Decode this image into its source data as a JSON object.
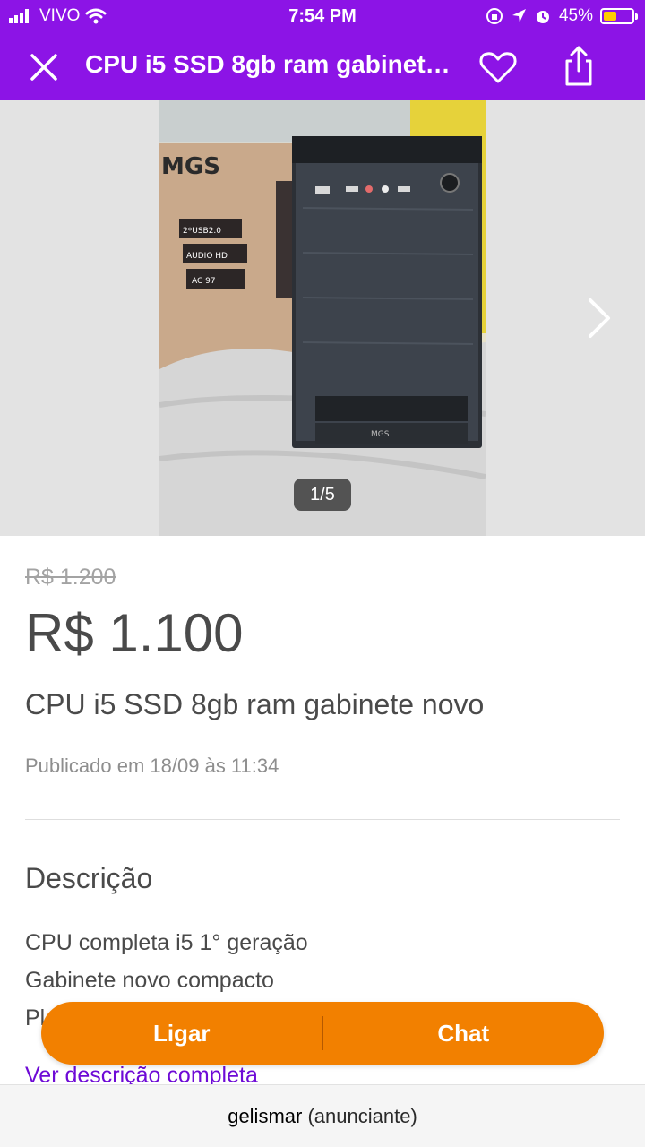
{
  "status_bar": {
    "carrier": "VIVO",
    "time": "7:54 PM",
    "battery": "45%",
    "battery_level": 0.45,
    "icons": [
      "signal-icon",
      "wifi-icon",
      "orientation-lock-icon",
      "location-icon",
      "alarm-icon",
      "battery-icon"
    ]
  },
  "app_bar": {
    "title": "CPU i5 SSD 8gb ram gabinete novo",
    "close_icon": "close-icon",
    "favorite_icon": "heart-icon",
    "share_icon": "share-icon",
    "color": "#8c14e6"
  },
  "gallery": {
    "counter": "1/5",
    "next_icon": "chevron-right-icon",
    "photo_text": {
      "brand": "MGS",
      "box_labels": [
        "2*USB2.0",
        "AUDIO HD",
        "AC 97"
      ]
    }
  },
  "listing": {
    "old_price": "R$ 1.200",
    "price": "R$ 1.100",
    "title": "CPU i5 SSD 8gb ram gabinete novo",
    "published": "Publicado em 18/09 às 11:34"
  },
  "description": {
    "heading": "Descrição",
    "lines": [
      "CPU completa i5 1° geração",
      "Gabinete novo compacto",
      "Pl"
    ],
    "see_more": "Ver descrição completa"
  },
  "actions": {
    "call_label": "Ligar",
    "chat_label": "Chat",
    "color": "#f28000"
  },
  "footer": {
    "seller_name": "gelismar",
    "seller_role": "(anunciante)"
  }
}
